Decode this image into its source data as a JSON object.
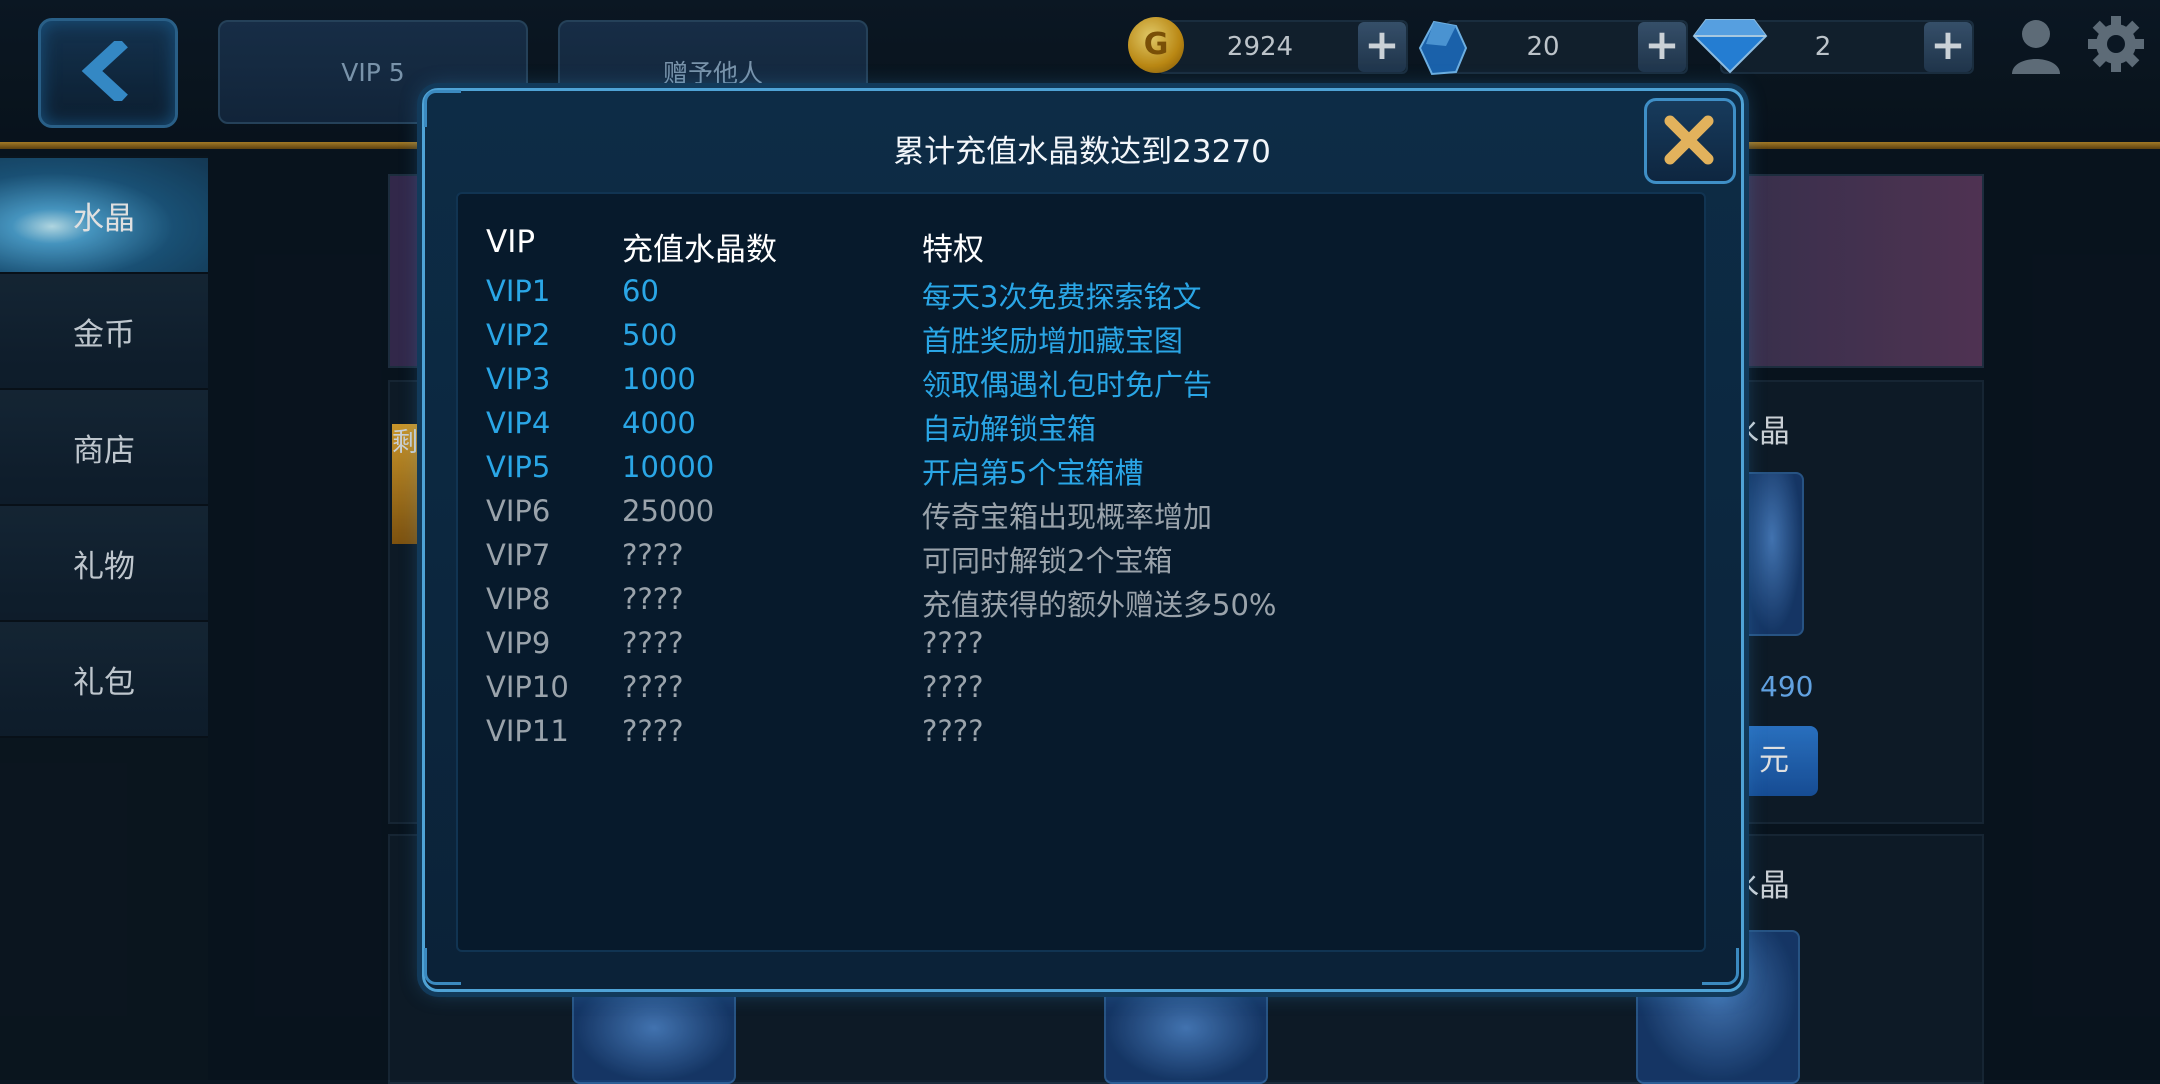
{
  "top_tabs": {
    "vip": "VIP 5",
    "gift": "赠予他人"
  },
  "currencies": {
    "gold": {
      "icon": "gold-coin-icon",
      "glyph": "G",
      "value": "2924"
    },
    "crystal": {
      "icon": "blue-crystal-icon",
      "value": "20"
    },
    "diamond": {
      "icon": "diamond-icon",
      "value": "2"
    },
    "plus_symbol": "+"
  },
  "sidebar": {
    "items": [
      {
        "label": "水晶",
        "active": true
      },
      {
        "label": "金币"
      },
      {
        "label": "商店"
      },
      {
        "label": "礼物"
      },
      {
        "label": "礼包"
      }
    ]
  },
  "background": {
    "card1_title_partial": "水晶",
    "card1_price": "490",
    "card1_buy_partial": "元",
    "card2_title_partial": "水晶",
    "left_partial": "剩"
  },
  "popup": {
    "title": "累计充值水晶数达到23270",
    "headers": {
      "vip": "VIP",
      "amount": "充值水晶数",
      "privilege": "特权"
    },
    "rows": [
      {
        "vip": "VIP1",
        "amount": "60",
        "privilege": "每天3次免费探索铭文",
        "unlocked": true
      },
      {
        "vip": "VIP2",
        "amount": "500",
        "privilege": "首胜奖励增加藏宝图",
        "unlocked": true
      },
      {
        "vip": "VIP3",
        "amount": "1000",
        "privilege": "领取偶遇礼包时免广告",
        "unlocked": true
      },
      {
        "vip": "VIP4",
        "amount": "4000",
        "privilege": "自动解锁宝箱",
        "unlocked": true
      },
      {
        "vip": "VIP5",
        "amount": "10000",
        "privilege": "开启第5个宝箱槽",
        "unlocked": true
      },
      {
        "vip": "VIP6",
        "amount": "25000",
        "privilege": "传奇宝箱出现概率增加",
        "unlocked": false
      },
      {
        "vip": "VIP7",
        "amount": "????",
        "privilege": "可同时解锁2个宝箱",
        "unlocked": false
      },
      {
        "vip": "VIP8",
        "amount": "????",
        "privilege": "充值获得的额外赠送多50%",
        "unlocked": false
      },
      {
        "vip": "VIP9",
        "amount": "????",
        "privilege": "????",
        "unlocked": false
      },
      {
        "vip": "VIP10",
        "amount": "????",
        "privilege": "????",
        "unlocked": false
      },
      {
        "vip": "VIP11",
        "amount": "????",
        "privilege": "????",
        "unlocked": false
      }
    ]
  },
  "colors": {
    "unlocked_text": "#2aa6e6",
    "locked_text": "#9aa3ab",
    "accent_gold": "#b98a2c",
    "panel_border": "#4fa3d6"
  }
}
